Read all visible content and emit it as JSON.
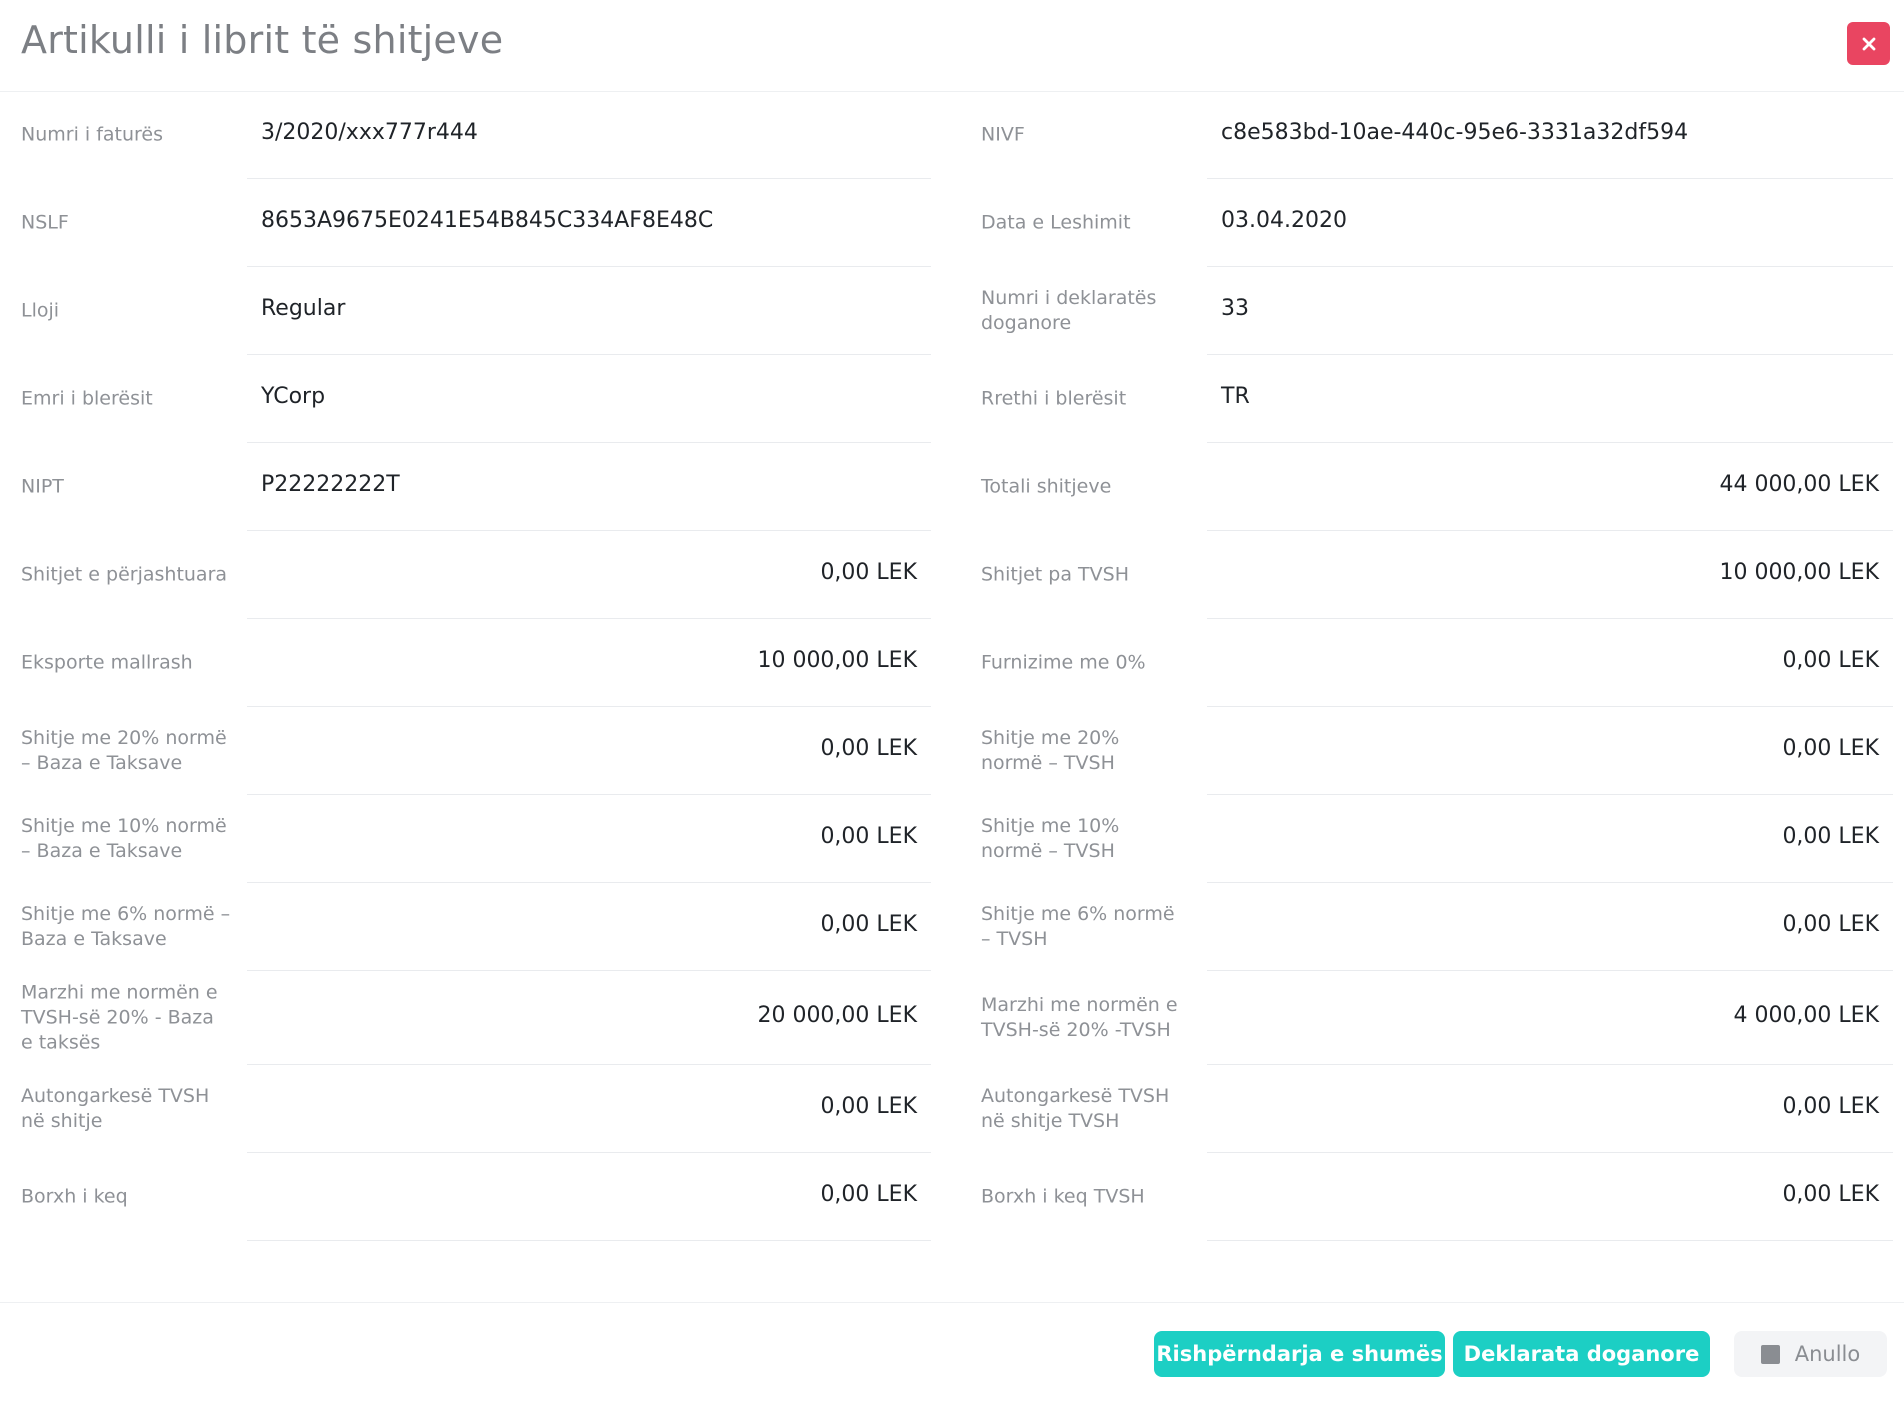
{
  "dialog": {
    "title": "Artikulli i librit të shitjeve",
    "close_label": "×"
  },
  "fields_left": [
    {
      "label": "Numri i faturës",
      "value": "3/2020/xxx777r444",
      "numeric": false
    },
    {
      "label": "NSLF",
      "value": "8653A9675E0241E54B845C334AF8E48C",
      "numeric": false
    },
    {
      "label": "Lloji",
      "value": "Regular",
      "numeric": false
    },
    {
      "label": "Emri i blerësit",
      "value": "YCorp",
      "numeric": false
    },
    {
      "label": "NIPT",
      "value": "P22222222T",
      "numeric": false
    },
    {
      "label": "Shitjet e përjashtuara",
      "value": "0,00 LEK",
      "numeric": true
    },
    {
      "label": "Eksporte mallrash",
      "value": "10 000,00 LEK",
      "numeric": true
    },
    {
      "label": "Shitje me 20% normë – Baza e Taksave",
      "value": "0,00 LEK",
      "numeric": true
    },
    {
      "label": "Shitje me 10% normë – Baza e Taksave",
      "value": "0,00 LEK",
      "numeric": true
    },
    {
      "label": "Shitje me 6% normë – Baza e Taksave",
      "value": "0,00 LEK",
      "numeric": true
    },
    {
      "label": "Marzhi me normën e TVSH-së 20% - Baza e taksës",
      "value": "20 000,00 LEK",
      "numeric": true
    },
    {
      "label": "Autongarkesë TVSH në shitje",
      "value": "0,00 LEK",
      "numeric": true
    },
    {
      "label": "Borxh i keq",
      "value": "0,00 LEK",
      "numeric": true
    }
  ],
  "fields_right": [
    {
      "label": "NIVF",
      "value": "c8e583bd-10ae-440c-95e6-3331a32df594",
      "numeric": false
    },
    {
      "label": "Data e Leshimit",
      "value": "03.04.2020",
      "numeric": false
    },
    {
      "label": "Numri i deklaratës doganore",
      "value": "33",
      "numeric": false
    },
    {
      "label": "Rrethi i blerësit",
      "value": "TR",
      "numeric": false
    },
    {
      "label": "Totali shitjeve",
      "value": "44 000,00 LEK",
      "numeric": true
    },
    {
      "label": "Shitjet pa  TVSH",
      "value": "10 000,00 LEK",
      "numeric": true
    },
    {
      "label": "Furnizime me 0%",
      "value": "0,00 LEK",
      "numeric": true
    },
    {
      "label": "Shitje me 20% normë – TVSH",
      "value": "0,00 LEK",
      "numeric": true
    },
    {
      "label": "Shitje me 10% normë – TVSH",
      "value": "0,00 LEK",
      "numeric": true
    },
    {
      "label": "Shitje me 6% normë – TVSH",
      "value": "0,00 LEK",
      "numeric": true
    },
    {
      "label": "Marzhi me normën e TVSH-së 20% -TVSH",
      "value": "4 000,00 LEK",
      "numeric": true
    },
    {
      "label": "Autongarkesë TVSH në shitje TVSH",
      "value": "0,00 LEK",
      "numeric": true
    },
    {
      "label": "Borxh i keq TVSH",
      "value": "0,00 LEK",
      "numeric": true
    }
  ],
  "footer": {
    "redistribute_label": "Rishpërndarja e shumës",
    "customs_label": "Deklarata doganore",
    "cancel_label": "Anullo"
  },
  "colors": {
    "accent_teal": "#1ccfc4",
    "close_red": "#e94561"
  }
}
